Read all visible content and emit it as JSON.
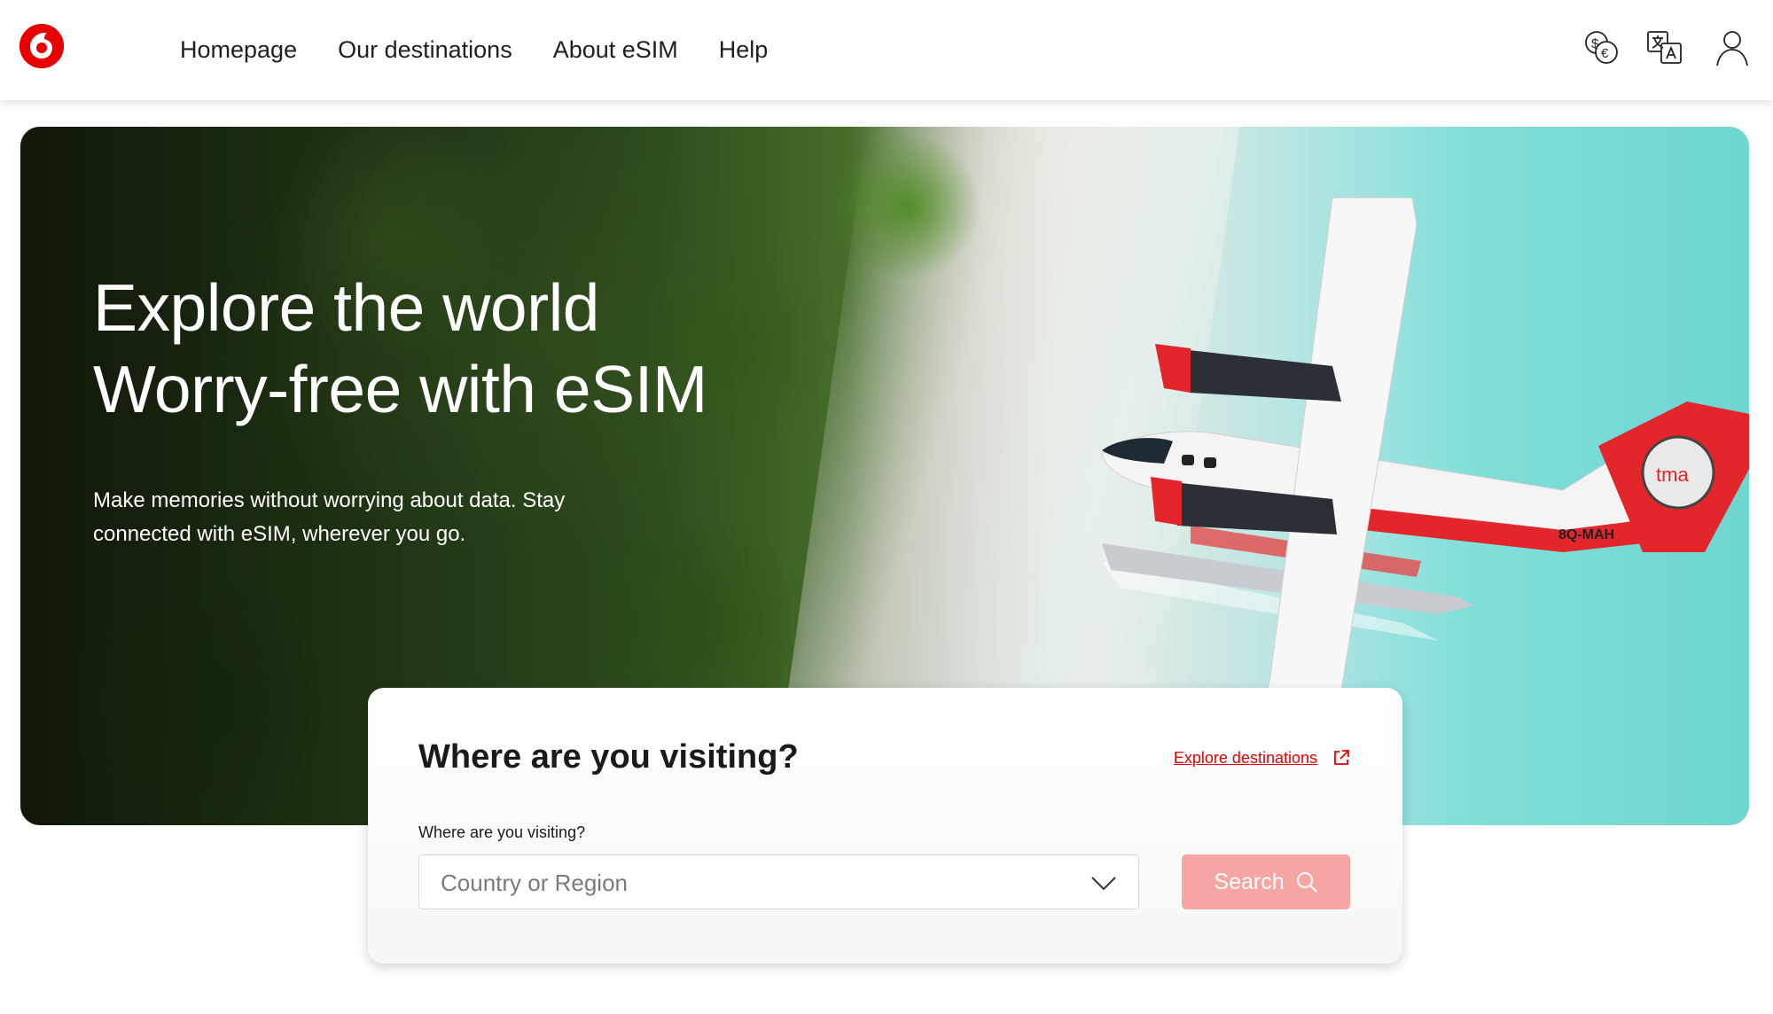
{
  "header": {
    "brand_icon": "vodafone-logo",
    "nav": [
      {
        "label": "Homepage"
      },
      {
        "label": "Our destinations"
      },
      {
        "label": "About eSIM"
      },
      {
        "label": "Help"
      }
    ],
    "icons": [
      "currency-icon",
      "language-icon",
      "user-account-icon"
    ]
  },
  "hero": {
    "title_line1": "Explore the world",
    "title_line2": "Worry-free with eSIM",
    "subtitle": "Make memories without worrying about data. Stay connected with eSIM, wherever you go.",
    "plane_registration": "8Q-MAH",
    "plane_logo_text": "tma"
  },
  "search": {
    "title": "Where are you visiting?",
    "explore_link": "Explore destinations",
    "field_label": "Where are you visiting?",
    "placeholder": "Country or Region",
    "button_label": "Search"
  },
  "colors": {
    "brand_red": "#e60000",
    "search_button_disabled": "#f6a6a2"
  }
}
